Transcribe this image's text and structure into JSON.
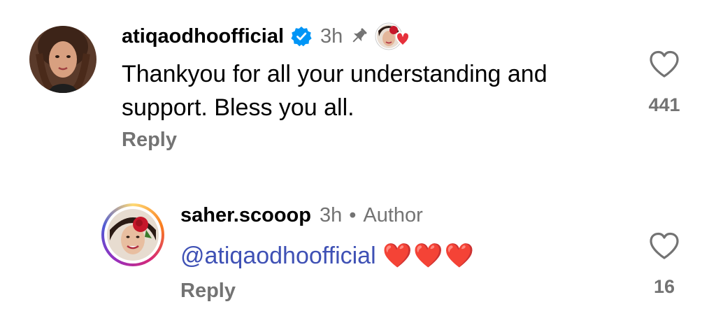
{
  "comments": [
    {
      "username": "atiqaodhoofficial",
      "verified": true,
      "time": "3h",
      "pinned": true,
      "text": "Thankyou for all your understanding and support. Bless you all.",
      "reply_label": "Reply",
      "likes": "441"
    },
    {
      "username": "saher.scooop",
      "time": "3h",
      "separator": "•",
      "author_label": "Author",
      "mention": "@atiqaodhoofficial",
      "emoji": "❤️❤️❤️",
      "reply_label": "Reply",
      "likes": "16"
    }
  ],
  "colors": {
    "verified_blue": "#0095f6",
    "secondary_text": "#737373",
    "mention_link": "#3f51b5",
    "heart_red": "#e6313c"
  }
}
